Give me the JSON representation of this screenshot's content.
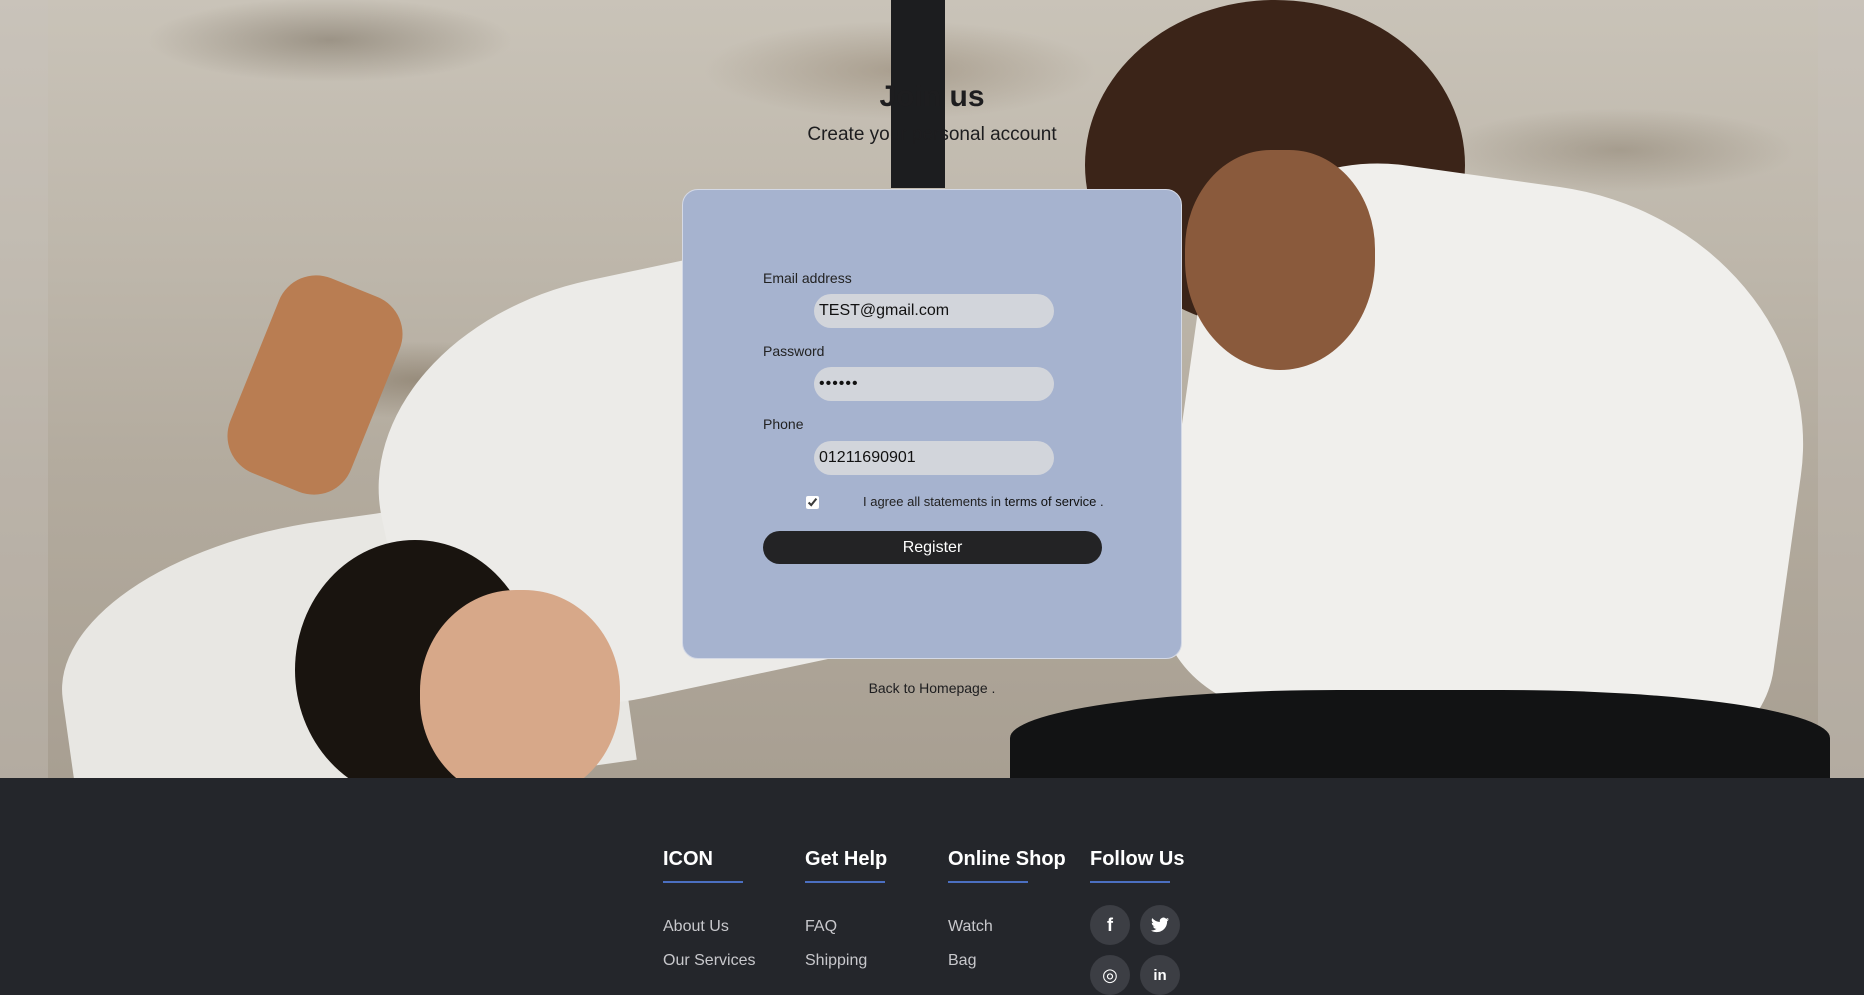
{
  "header": {
    "title": "Join us",
    "subtitle": "Create your personal account"
  },
  "form": {
    "email_label": "Email address",
    "email_value": "TEST@gmail.com",
    "password_label": "Password",
    "password_value": "••••••",
    "phone_label": "Phone",
    "phone_value": "01211690901",
    "agree_text": "I agree all statements in",
    "terms_link": "terms of service",
    "agree_suffix": ".",
    "agree_checked": true,
    "register_label": "Register"
  },
  "back_link": "Back to Homepage .",
  "footer": {
    "columns": [
      {
        "title": "ICON",
        "links": [
          "About Us",
          "Our Services"
        ]
      },
      {
        "title": "Get Help",
        "links": [
          "FAQ",
          "Shipping"
        ]
      },
      {
        "title": "Online Shop",
        "links": [
          "Watch",
          "Bag"
        ]
      },
      {
        "title": "Follow Us",
        "links": []
      }
    ],
    "social": [
      "facebook-icon",
      "twitter-icon",
      "instagram-icon",
      "linkedin-icon"
    ]
  },
  "colors": {
    "card_bg": "#a6b3cf",
    "footer_bg": "#24262b",
    "accent_underline": "#4b6fc1",
    "button_bg": "#232325"
  }
}
